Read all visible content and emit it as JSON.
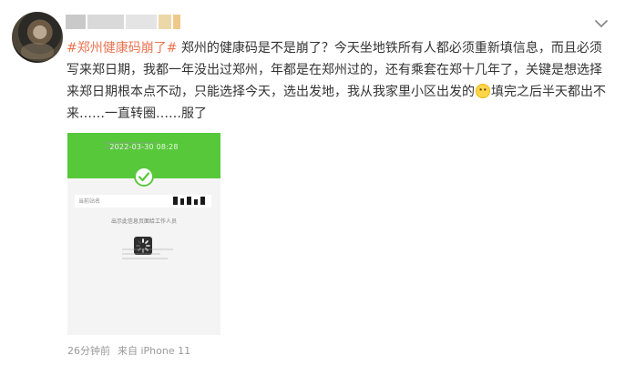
{
  "author": {
    "avatar_icon": "user-avatar",
    "username_obscured": true
  },
  "post": {
    "topic": "#郑州健康码崩了#",
    "text": " 郑州的健康码是不是崩了？今天坐地铁所有人都必须重新填信息，而且必须写来郑日期，我都一年没出过郑州，年都是在郑州过的，还有乘套在郑十几年了，关键是想选择来郑日期根本点不动，只能选择今天，选出发地，我从我家里小区出发的",
    "emoji_icon": "grin-emoji-icon",
    "text_after_emoji": "填完之后半天都出不来……一直转圈……服了"
  },
  "attached_image": {
    "datetime": "2022-03-30 08:28",
    "station_label": "当前站名",
    "note": "出示此信息页面给工作人员",
    "header_color": "#57c83a",
    "status_icon": "check-circle-icon",
    "loading_icon": "spinner-icon"
  },
  "meta": {
    "time": "26分钟前",
    "source": "来自 iPhone 11"
  },
  "controls": {
    "more_icon": "chevron-down-icon"
  },
  "colors": {
    "topic": "#eb7350",
    "text": "#333333",
    "meta": "#999999"
  }
}
